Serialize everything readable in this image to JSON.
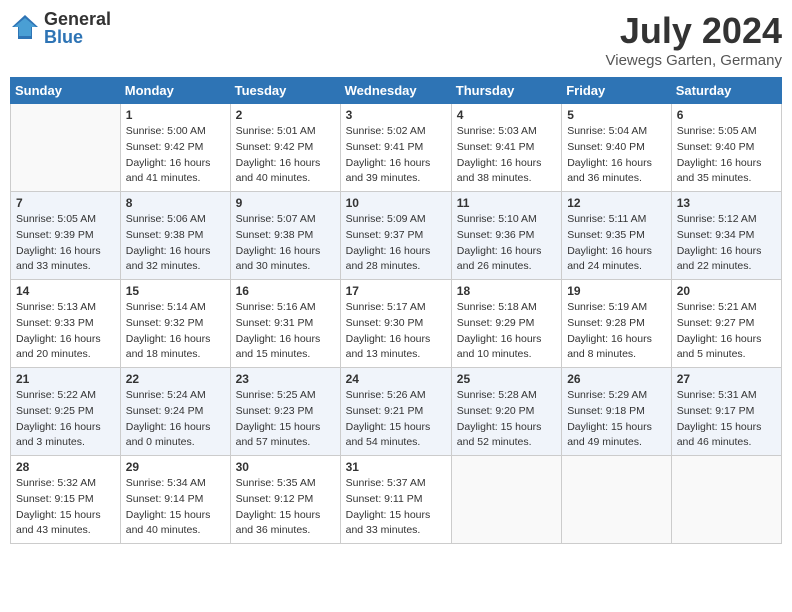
{
  "logo": {
    "general": "General",
    "blue": "Blue"
  },
  "title": "July 2024",
  "location": "Viewegs Garten, Germany",
  "days_of_week": [
    "Sunday",
    "Monday",
    "Tuesday",
    "Wednesday",
    "Thursday",
    "Friday",
    "Saturday"
  ],
  "weeks": [
    [
      {
        "day": "",
        "info": ""
      },
      {
        "day": "1",
        "info": "Sunrise: 5:00 AM\nSunset: 9:42 PM\nDaylight: 16 hours\nand 41 minutes."
      },
      {
        "day": "2",
        "info": "Sunrise: 5:01 AM\nSunset: 9:42 PM\nDaylight: 16 hours\nand 40 minutes."
      },
      {
        "day": "3",
        "info": "Sunrise: 5:02 AM\nSunset: 9:41 PM\nDaylight: 16 hours\nand 39 minutes."
      },
      {
        "day": "4",
        "info": "Sunrise: 5:03 AM\nSunset: 9:41 PM\nDaylight: 16 hours\nand 38 minutes."
      },
      {
        "day": "5",
        "info": "Sunrise: 5:04 AM\nSunset: 9:40 PM\nDaylight: 16 hours\nand 36 minutes."
      },
      {
        "day": "6",
        "info": "Sunrise: 5:05 AM\nSunset: 9:40 PM\nDaylight: 16 hours\nand 35 minutes."
      }
    ],
    [
      {
        "day": "7",
        "info": "Sunrise: 5:05 AM\nSunset: 9:39 PM\nDaylight: 16 hours\nand 33 minutes."
      },
      {
        "day": "8",
        "info": "Sunrise: 5:06 AM\nSunset: 9:38 PM\nDaylight: 16 hours\nand 32 minutes."
      },
      {
        "day": "9",
        "info": "Sunrise: 5:07 AM\nSunset: 9:38 PM\nDaylight: 16 hours\nand 30 minutes."
      },
      {
        "day": "10",
        "info": "Sunrise: 5:09 AM\nSunset: 9:37 PM\nDaylight: 16 hours\nand 28 minutes."
      },
      {
        "day": "11",
        "info": "Sunrise: 5:10 AM\nSunset: 9:36 PM\nDaylight: 16 hours\nand 26 minutes."
      },
      {
        "day": "12",
        "info": "Sunrise: 5:11 AM\nSunset: 9:35 PM\nDaylight: 16 hours\nand 24 minutes."
      },
      {
        "day": "13",
        "info": "Sunrise: 5:12 AM\nSunset: 9:34 PM\nDaylight: 16 hours\nand 22 minutes."
      }
    ],
    [
      {
        "day": "14",
        "info": "Sunrise: 5:13 AM\nSunset: 9:33 PM\nDaylight: 16 hours\nand 20 minutes."
      },
      {
        "day": "15",
        "info": "Sunrise: 5:14 AM\nSunset: 9:32 PM\nDaylight: 16 hours\nand 18 minutes."
      },
      {
        "day": "16",
        "info": "Sunrise: 5:16 AM\nSunset: 9:31 PM\nDaylight: 16 hours\nand 15 minutes."
      },
      {
        "day": "17",
        "info": "Sunrise: 5:17 AM\nSunset: 9:30 PM\nDaylight: 16 hours\nand 13 minutes."
      },
      {
        "day": "18",
        "info": "Sunrise: 5:18 AM\nSunset: 9:29 PM\nDaylight: 16 hours\nand 10 minutes."
      },
      {
        "day": "19",
        "info": "Sunrise: 5:19 AM\nSunset: 9:28 PM\nDaylight: 16 hours\nand 8 minutes."
      },
      {
        "day": "20",
        "info": "Sunrise: 5:21 AM\nSunset: 9:27 PM\nDaylight: 16 hours\nand 5 minutes."
      }
    ],
    [
      {
        "day": "21",
        "info": "Sunrise: 5:22 AM\nSunset: 9:25 PM\nDaylight: 16 hours\nand 3 minutes."
      },
      {
        "day": "22",
        "info": "Sunrise: 5:24 AM\nSunset: 9:24 PM\nDaylight: 16 hours\nand 0 minutes."
      },
      {
        "day": "23",
        "info": "Sunrise: 5:25 AM\nSunset: 9:23 PM\nDaylight: 15 hours\nand 57 minutes."
      },
      {
        "day": "24",
        "info": "Sunrise: 5:26 AM\nSunset: 9:21 PM\nDaylight: 15 hours\nand 54 minutes."
      },
      {
        "day": "25",
        "info": "Sunrise: 5:28 AM\nSunset: 9:20 PM\nDaylight: 15 hours\nand 52 minutes."
      },
      {
        "day": "26",
        "info": "Sunrise: 5:29 AM\nSunset: 9:18 PM\nDaylight: 15 hours\nand 49 minutes."
      },
      {
        "day": "27",
        "info": "Sunrise: 5:31 AM\nSunset: 9:17 PM\nDaylight: 15 hours\nand 46 minutes."
      }
    ],
    [
      {
        "day": "28",
        "info": "Sunrise: 5:32 AM\nSunset: 9:15 PM\nDaylight: 15 hours\nand 43 minutes."
      },
      {
        "day": "29",
        "info": "Sunrise: 5:34 AM\nSunset: 9:14 PM\nDaylight: 15 hours\nand 40 minutes."
      },
      {
        "day": "30",
        "info": "Sunrise: 5:35 AM\nSunset: 9:12 PM\nDaylight: 15 hours\nand 36 minutes."
      },
      {
        "day": "31",
        "info": "Sunrise: 5:37 AM\nSunset: 9:11 PM\nDaylight: 15 hours\nand 33 minutes."
      },
      {
        "day": "",
        "info": ""
      },
      {
        "day": "",
        "info": ""
      },
      {
        "day": "",
        "info": ""
      }
    ]
  ]
}
